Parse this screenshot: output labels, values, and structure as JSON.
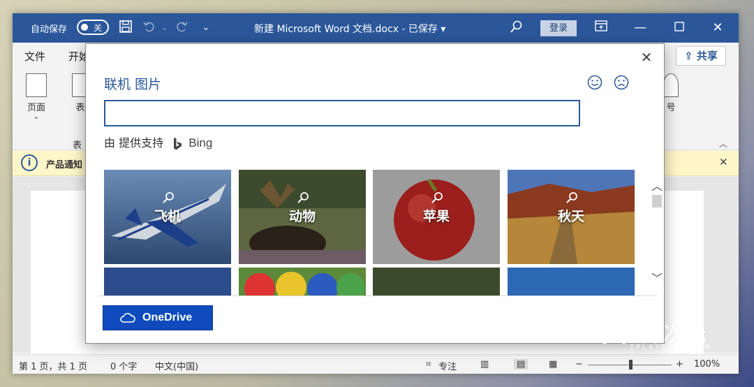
{
  "titlebar": {
    "autosave_label": "自动保存",
    "autosave_state": "关",
    "doc_title": "新建 Microsoft Word 文档.docx  -  已保存  ▾",
    "signin_label": "登录"
  },
  "ribbon": {
    "tabs": [
      "文件",
      "开始"
    ],
    "share_label": "共享",
    "buttons": {
      "page": "页面",
      "table": "表",
      "table_group": "表",
      "symbol": "号"
    }
  },
  "infobar": {
    "text": "产品通知"
  },
  "statusbar": {
    "page_info": "第 1 页，共 1 页",
    "word_count": "0 个字",
    "language": "中文(中国)",
    "focus": "专注",
    "zoom": "100%",
    "minus": "−",
    "plus": "+"
  },
  "dialog": {
    "title": "联机 图片",
    "search_value": "",
    "powered_by": "由 提供支持",
    "bing_label": "Bing",
    "tiles": [
      {
        "label": "飞机",
        "color": "#4d6f9a"
      },
      {
        "label": "动物",
        "color": "#4a4a36"
      },
      {
        "label": "苹果",
        "color": "#8e2d2a"
      },
      {
        "label": "秋天",
        "color": "#9a6a2c"
      }
    ],
    "tiles_row2_colors": [
      "#2d4c8c",
      "#5d8a3a",
      "#3a4a2a",
      "#2c68b4"
    ],
    "onedrive_label": "OneDrive"
  },
  "watermark": {
    "brand": "异次元",
    "site": "IPLAYSOFT.COM"
  }
}
